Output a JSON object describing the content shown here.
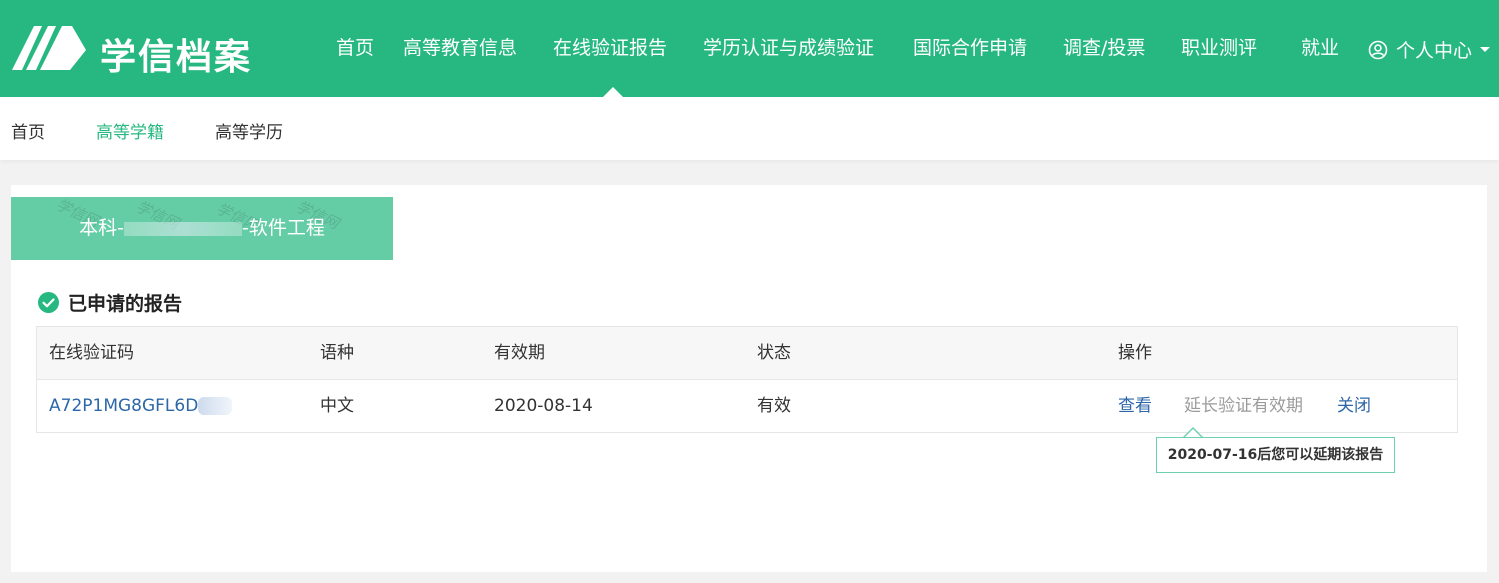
{
  "header": {
    "logo_text": "学信档案",
    "nav": [
      {
        "label": "首页",
        "id": "home"
      },
      {
        "label": "高等教育信息",
        "id": "higher-edu-info"
      },
      {
        "label": "在线验证报告",
        "id": "online-verification-report"
      },
      {
        "label": "学历认证与成绩验证",
        "id": "degree-certification"
      },
      {
        "label": "国际合作申请",
        "id": "international-cooperation"
      },
      {
        "label": "调查/投票",
        "id": "survey-vote"
      },
      {
        "label": "职业测评",
        "id": "career-assessment"
      },
      {
        "label": "就业",
        "id": "employment"
      }
    ],
    "active_nav": "在线验证报告",
    "user_center": "个人中心"
  },
  "subnav": {
    "items": [
      "首页",
      "高等学籍",
      "高等学历"
    ],
    "active": "高等学籍"
  },
  "degree_tab": {
    "prefix": "本科-",
    "suffix": "-软件工程",
    "watermark": "学信网"
  },
  "section": {
    "title": "已申请的报告"
  },
  "table": {
    "headers": [
      "在线验证码",
      "语种",
      "有效期",
      "状态",
      "操作"
    ],
    "rows": [
      {
        "code": "A72P1MG8GFL6D",
        "language": "中文",
        "valid_until": "2020-08-14",
        "status": "有效",
        "actions": {
          "view": "查看",
          "extend": "延长验证有效期",
          "close": "关闭"
        }
      }
    ]
  },
  "tooltip": {
    "text": "2020-07-16后您可以延期该报告"
  },
  "colors": {
    "brand_green": "#27b882",
    "tab_green": "#65cda6",
    "link_blue": "#2c67a8"
  }
}
